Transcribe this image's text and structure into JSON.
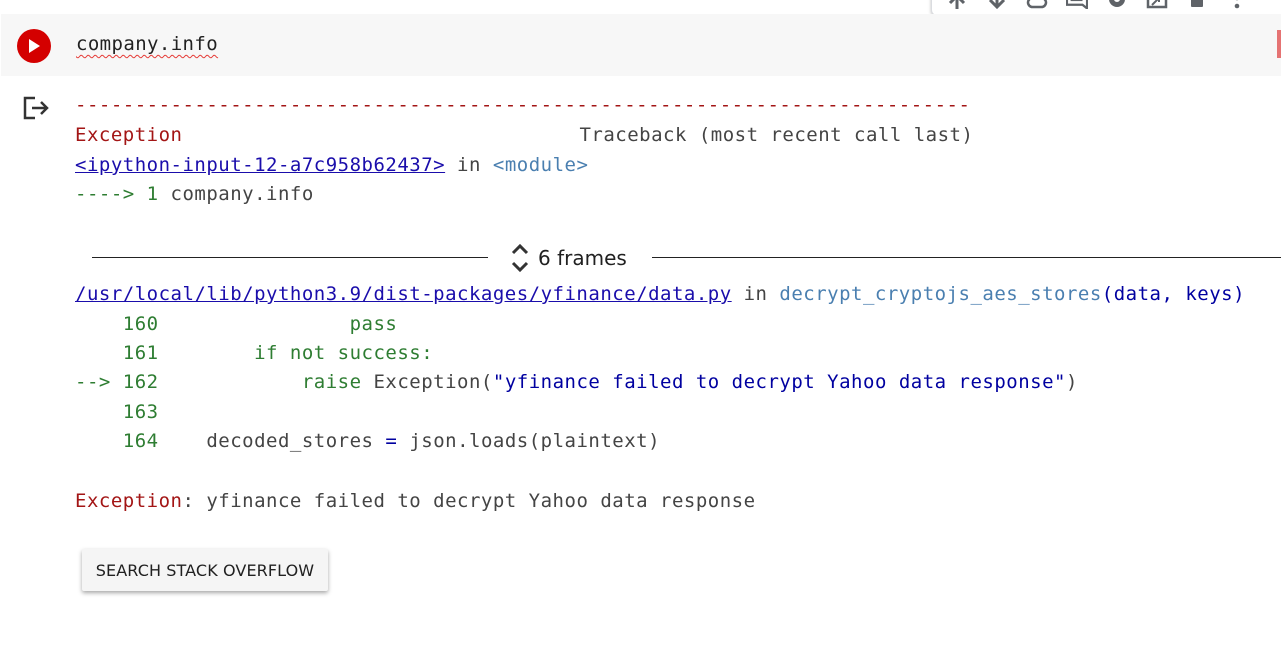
{
  "cell": {
    "code": "company.info"
  },
  "output": {
    "separator": "---------------------------------------------------------------------------",
    "exception_name": "Exception",
    "traceback_header": "Traceback (most recent call last)",
    "input_link": "<ipython-input-12-a7c958b62437>",
    "in_word": " in ",
    "module": "<module>",
    "arrow_line_prefix": "----> 1 ",
    "arrow_line_code": "company.info",
    "frames_label": "6 frames",
    "file_link": "/usr/local/lib/python3.9/dist-packages/yfinance/data.py",
    "function_name": "decrypt_cryptojs_aes_stores",
    "function_args": "(data, keys)",
    "code_lines": [
      {
        "prefix": "    160",
        "code": "                pass"
      },
      {
        "prefix": "    161",
        "code": "        if not success:"
      },
      {
        "prefix": "--> 162",
        "code_kw": "            raise",
        "code_rest": " Exception(",
        "code_str": "\"yfinance failed to decrypt Yahoo data response\"",
        "code_end": ")"
      },
      {
        "prefix": "    163",
        "code": ""
      },
      {
        "prefix": "    164",
        "code_a": "    decoded_stores ",
        "code_op": "=",
        "code_b": " json.loads(plaintext)"
      }
    ],
    "final_exception_name": "Exception",
    "final_exception_message": ": yfinance failed to decrypt Yahoo data response",
    "search_button_label": "SEARCH STACK OVERFLOW"
  },
  "colors": {
    "run_button": "#d40000",
    "exception": "#a31515",
    "line_numbers": "#2e7d32",
    "link": "#1a0dab"
  },
  "icons": [
    "arrow-up-icon",
    "arrow-down-icon",
    "link-icon",
    "comment-icon",
    "gear-icon",
    "mirror-cell-icon",
    "delete-icon",
    "more-vert-icon",
    "play-icon",
    "output-exit-icon",
    "unfold-icon"
  ]
}
